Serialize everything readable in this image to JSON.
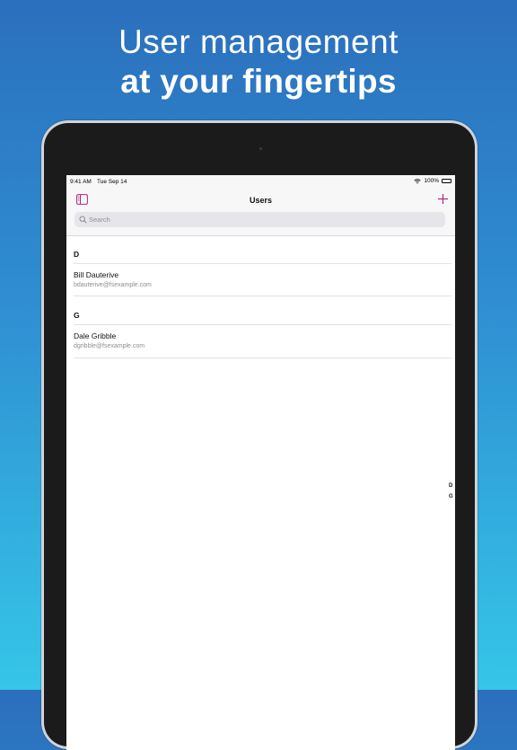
{
  "headline": {
    "line1": "User management",
    "line2": "at your fingertips"
  },
  "status_bar": {
    "time": "9:41 AM",
    "date": "Tue Sep 14",
    "battery": "100%"
  },
  "nav": {
    "title": "Users",
    "sidebar_icon": "sidebar-icon",
    "add_icon": "plus-icon"
  },
  "search": {
    "placeholder": "Search"
  },
  "sections": [
    {
      "letter": "D",
      "users": [
        {
          "name": "Bill Dauterive",
          "email": "bdauterive@fsexample.com"
        }
      ]
    },
    {
      "letter": "G",
      "users": [
        {
          "name": "Dale Gribble",
          "email": "dgribble@fsexample.com"
        }
      ]
    }
  ],
  "index": [
    "D",
    "G"
  ],
  "colors": {
    "accent": "#b0267a",
    "background_top": "#2b6fbd",
    "background_bottom": "#35c6e8"
  }
}
